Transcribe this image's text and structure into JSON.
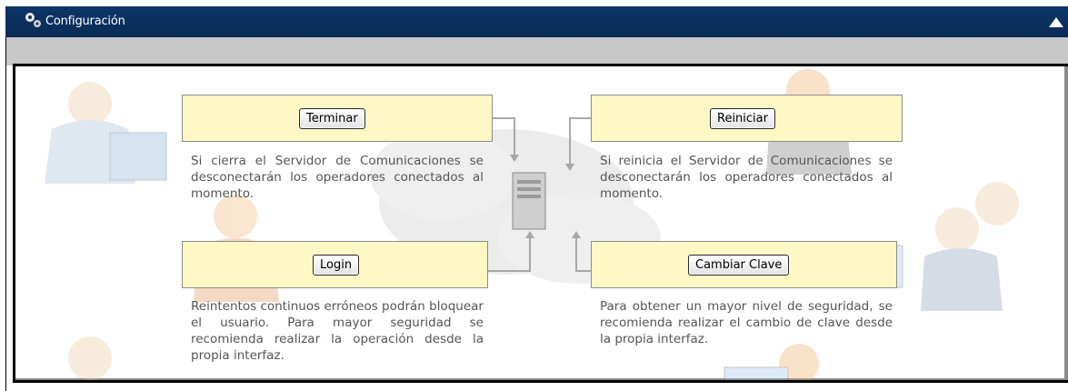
{
  "window": {
    "title": "Configuración"
  },
  "actions": [
    {
      "button": "Terminar",
      "description": "Si cierra el Servidor de Comunicaciones se desconectarán los operadores conectados al momento."
    },
    {
      "button": "Reiniciar",
      "description": "Si reinicia el Servidor de Comunicaciones se desconectarán los operadores conectados al momento."
    },
    {
      "button": "Login",
      "description": "Reintentos continuos erróneos podrán bloquear el usuario. Para mayor seguridad se recomienda realizar la operación desde la propia interfaz."
    },
    {
      "button": "Cambiar Clave",
      "description": "Para obtener un mayor nivel de seguridad, se recomienda realizar el cambio de clave desde la propia interfaz."
    }
  ],
  "colors": {
    "titlebar": "#0a2b56",
    "highlight": "#fdf8c4",
    "text": "#555555"
  }
}
